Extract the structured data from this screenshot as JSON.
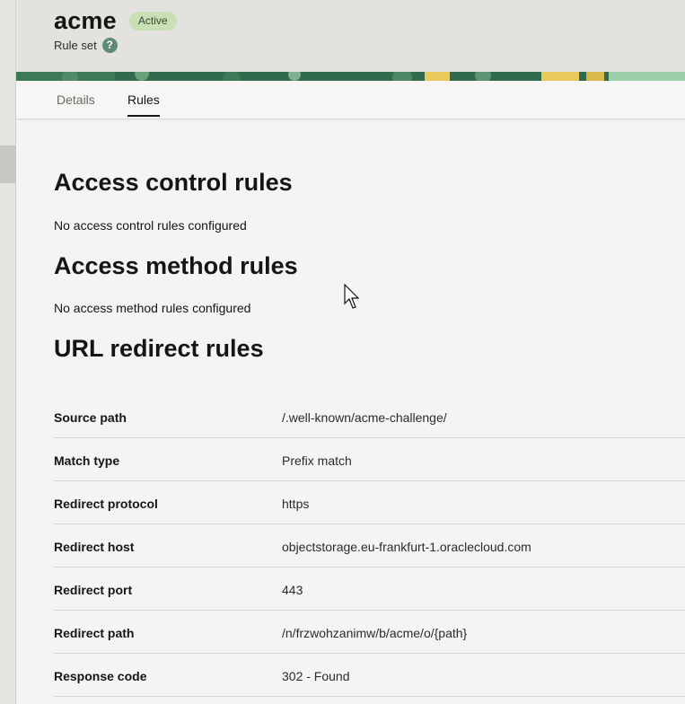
{
  "header": {
    "title": "acme",
    "status": "Active",
    "subtitle": "Rule set",
    "help_glyph": "?"
  },
  "tabs": [
    {
      "label": "Details",
      "active": false
    },
    {
      "label": "Rules",
      "active": true
    }
  ],
  "sections": {
    "access_control": {
      "heading": "Access control rules",
      "empty_text": "No access control rules configured"
    },
    "access_method": {
      "heading": "Access method rules",
      "empty_text": "No access method rules configured"
    },
    "url_redirect": {
      "heading": "URL redirect rules"
    }
  },
  "redirect_rules": [
    {
      "label": "Source path",
      "value": "/.well-known/acme-challenge/"
    },
    {
      "label": "Match type",
      "value": "Prefix match"
    },
    {
      "label": "Redirect protocol",
      "value": "https"
    },
    {
      "label": "Redirect host",
      "value": "objectstorage.eu-frankfurt-1.oraclecloud.com"
    },
    {
      "label": "Redirect port",
      "value": "443"
    },
    {
      "label": "Redirect path",
      "value": "/n/frzwohzanimw/b/acme/o/{path}"
    },
    {
      "label": "Response code",
      "value": "302 - Found"
    }
  ],
  "colors": {
    "badge_bg": "#c9dfb6",
    "help_icon": "#5f8a73",
    "banner_green": "#2f6b4c",
    "banner_yellow": "#e8c95a"
  },
  "icons": {
    "help": "help-icon",
    "cursor": "mouse-pointer-icon"
  }
}
